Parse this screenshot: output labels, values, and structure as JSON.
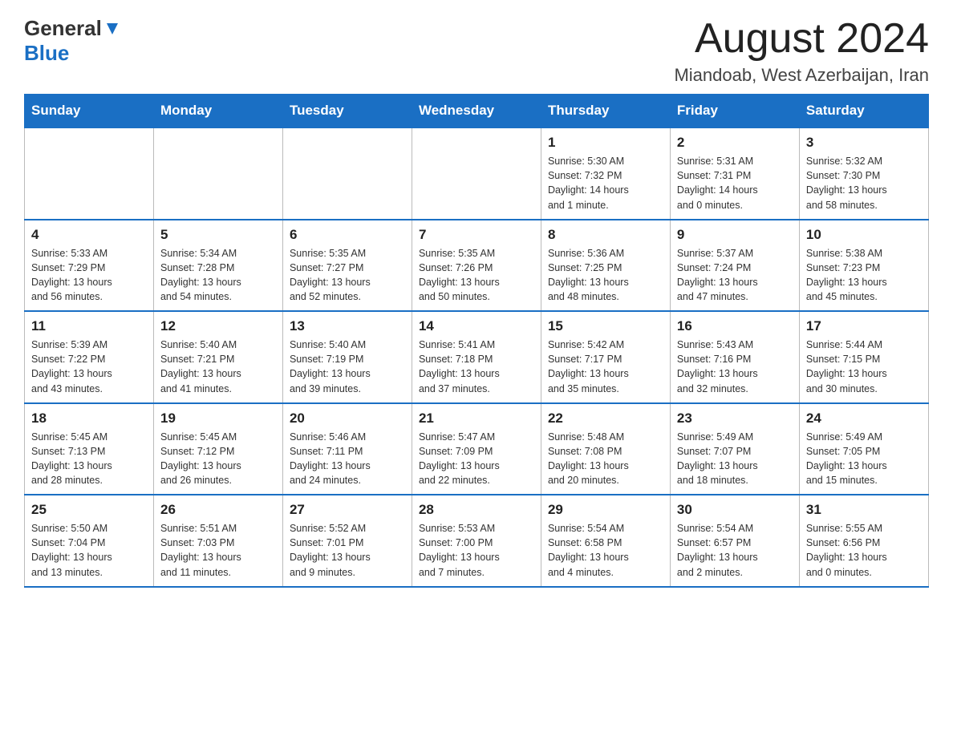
{
  "header": {
    "logo_general": "General",
    "logo_blue": "Blue",
    "month_title": "August 2024",
    "location": "Miandoab, West Azerbaijan, Iran"
  },
  "weekdays": [
    "Sunday",
    "Monday",
    "Tuesday",
    "Wednesday",
    "Thursday",
    "Friday",
    "Saturday"
  ],
  "weeks": [
    {
      "days": [
        {
          "num": "",
          "info": ""
        },
        {
          "num": "",
          "info": ""
        },
        {
          "num": "",
          "info": ""
        },
        {
          "num": "",
          "info": ""
        },
        {
          "num": "1",
          "info": "Sunrise: 5:30 AM\nSunset: 7:32 PM\nDaylight: 14 hours\nand 1 minute."
        },
        {
          "num": "2",
          "info": "Sunrise: 5:31 AM\nSunset: 7:31 PM\nDaylight: 14 hours\nand 0 minutes."
        },
        {
          "num": "3",
          "info": "Sunrise: 5:32 AM\nSunset: 7:30 PM\nDaylight: 13 hours\nand 58 minutes."
        }
      ]
    },
    {
      "days": [
        {
          "num": "4",
          "info": "Sunrise: 5:33 AM\nSunset: 7:29 PM\nDaylight: 13 hours\nand 56 minutes."
        },
        {
          "num": "5",
          "info": "Sunrise: 5:34 AM\nSunset: 7:28 PM\nDaylight: 13 hours\nand 54 minutes."
        },
        {
          "num": "6",
          "info": "Sunrise: 5:35 AM\nSunset: 7:27 PM\nDaylight: 13 hours\nand 52 minutes."
        },
        {
          "num": "7",
          "info": "Sunrise: 5:35 AM\nSunset: 7:26 PM\nDaylight: 13 hours\nand 50 minutes."
        },
        {
          "num": "8",
          "info": "Sunrise: 5:36 AM\nSunset: 7:25 PM\nDaylight: 13 hours\nand 48 minutes."
        },
        {
          "num": "9",
          "info": "Sunrise: 5:37 AM\nSunset: 7:24 PM\nDaylight: 13 hours\nand 47 minutes."
        },
        {
          "num": "10",
          "info": "Sunrise: 5:38 AM\nSunset: 7:23 PM\nDaylight: 13 hours\nand 45 minutes."
        }
      ]
    },
    {
      "days": [
        {
          "num": "11",
          "info": "Sunrise: 5:39 AM\nSunset: 7:22 PM\nDaylight: 13 hours\nand 43 minutes."
        },
        {
          "num": "12",
          "info": "Sunrise: 5:40 AM\nSunset: 7:21 PM\nDaylight: 13 hours\nand 41 minutes."
        },
        {
          "num": "13",
          "info": "Sunrise: 5:40 AM\nSunset: 7:19 PM\nDaylight: 13 hours\nand 39 minutes."
        },
        {
          "num": "14",
          "info": "Sunrise: 5:41 AM\nSunset: 7:18 PM\nDaylight: 13 hours\nand 37 minutes."
        },
        {
          "num": "15",
          "info": "Sunrise: 5:42 AM\nSunset: 7:17 PM\nDaylight: 13 hours\nand 35 minutes."
        },
        {
          "num": "16",
          "info": "Sunrise: 5:43 AM\nSunset: 7:16 PM\nDaylight: 13 hours\nand 32 minutes."
        },
        {
          "num": "17",
          "info": "Sunrise: 5:44 AM\nSunset: 7:15 PM\nDaylight: 13 hours\nand 30 minutes."
        }
      ]
    },
    {
      "days": [
        {
          "num": "18",
          "info": "Sunrise: 5:45 AM\nSunset: 7:13 PM\nDaylight: 13 hours\nand 28 minutes."
        },
        {
          "num": "19",
          "info": "Sunrise: 5:45 AM\nSunset: 7:12 PM\nDaylight: 13 hours\nand 26 minutes."
        },
        {
          "num": "20",
          "info": "Sunrise: 5:46 AM\nSunset: 7:11 PM\nDaylight: 13 hours\nand 24 minutes."
        },
        {
          "num": "21",
          "info": "Sunrise: 5:47 AM\nSunset: 7:09 PM\nDaylight: 13 hours\nand 22 minutes."
        },
        {
          "num": "22",
          "info": "Sunrise: 5:48 AM\nSunset: 7:08 PM\nDaylight: 13 hours\nand 20 minutes."
        },
        {
          "num": "23",
          "info": "Sunrise: 5:49 AM\nSunset: 7:07 PM\nDaylight: 13 hours\nand 18 minutes."
        },
        {
          "num": "24",
          "info": "Sunrise: 5:49 AM\nSunset: 7:05 PM\nDaylight: 13 hours\nand 15 minutes."
        }
      ]
    },
    {
      "days": [
        {
          "num": "25",
          "info": "Sunrise: 5:50 AM\nSunset: 7:04 PM\nDaylight: 13 hours\nand 13 minutes."
        },
        {
          "num": "26",
          "info": "Sunrise: 5:51 AM\nSunset: 7:03 PM\nDaylight: 13 hours\nand 11 minutes."
        },
        {
          "num": "27",
          "info": "Sunrise: 5:52 AM\nSunset: 7:01 PM\nDaylight: 13 hours\nand 9 minutes."
        },
        {
          "num": "28",
          "info": "Sunrise: 5:53 AM\nSunset: 7:00 PM\nDaylight: 13 hours\nand 7 minutes."
        },
        {
          "num": "29",
          "info": "Sunrise: 5:54 AM\nSunset: 6:58 PM\nDaylight: 13 hours\nand 4 minutes."
        },
        {
          "num": "30",
          "info": "Sunrise: 5:54 AM\nSunset: 6:57 PM\nDaylight: 13 hours\nand 2 minutes."
        },
        {
          "num": "31",
          "info": "Sunrise: 5:55 AM\nSunset: 6:56 PM\nDaylight: 13 hours\nand 0 minutes."
        }
      ]
    }
  ]
}
